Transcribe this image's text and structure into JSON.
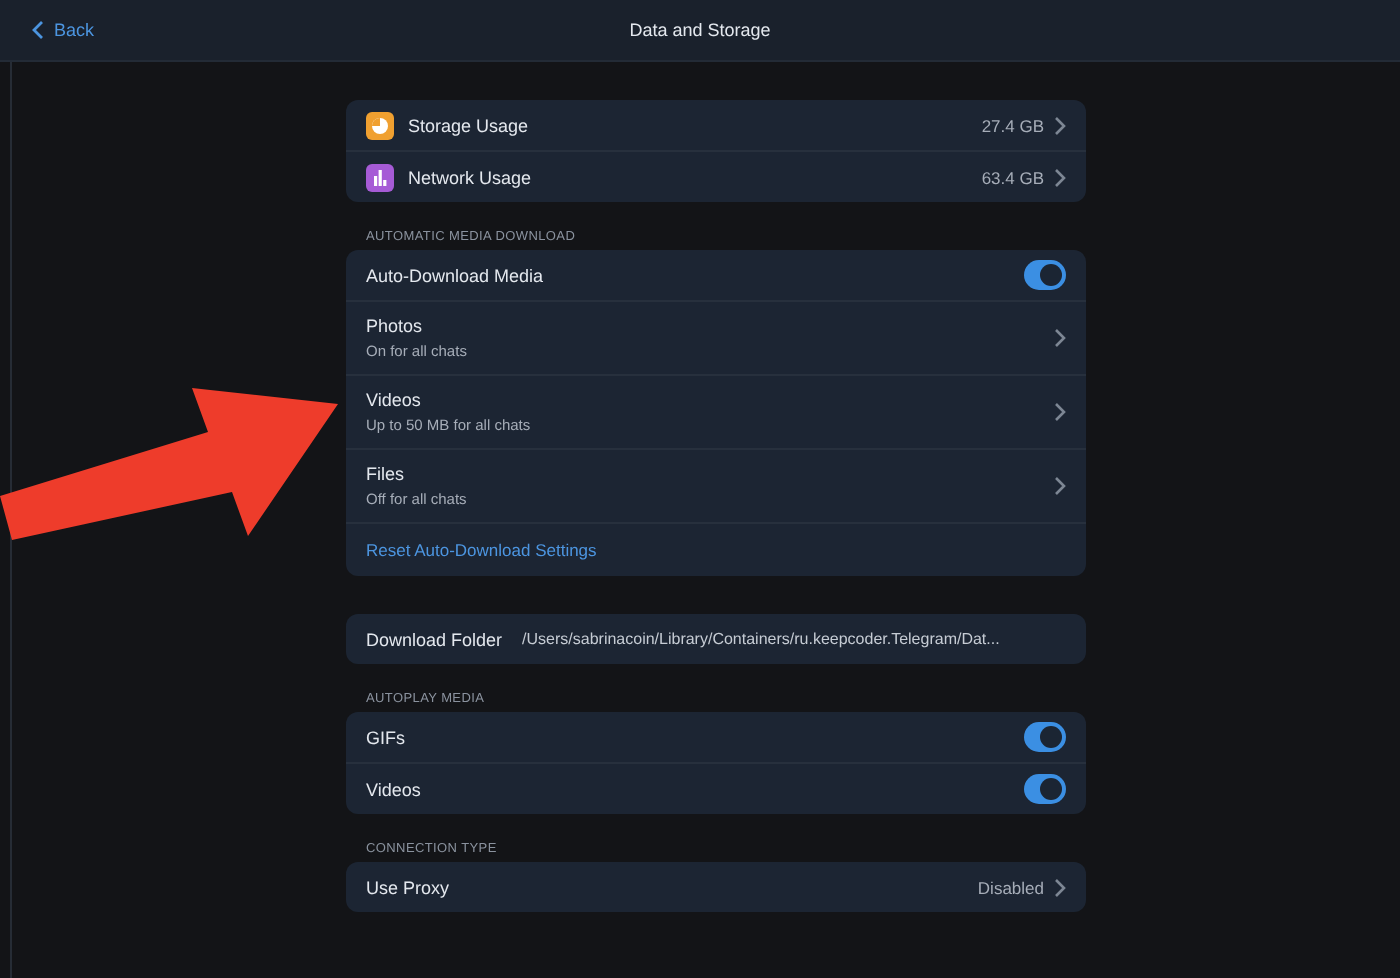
{
  "header": {
    "back": "Back",
    "title": "Data and Storage"
  },
  "sections": [
    {
      "rows": [
        {
          "kind": "storage",
          "label": "Storage Usage",
          "value": "27.4 GB",
          "color": "#f0a030"
        },
        {
          "kind": "network",
          "label": "Network Usage",
          "value": "63.4 GB",
          "color": "#a65bd6"
        }
      ]
    },
    {
      "title": "AUTOMATIC MEDIA DOWNLOAD",
      "rows": [
        {
          "kind": "toggle",
          "label": "Auto-Download Media",
          "on": true
        },
        {
          "kind": "detail",
          "label": "Photos",
          "subtitle": "On for all chats"
        },
        {
          "kind": "detail",
          "label": "Videos",
          "subtitle": "Up to 50 MB for all chats"
        },
        {
          "kind": "detail",
          "label": "Files",
          "subtitle": "Off for all chats"
        },
        {
          "kind": "link",
          "label": "Reset Auto-Download Settings"
        }
      ]
    },
    {
      "rows": [
        {
          "kind": "path",
          "label": "Download Folder",
          "value": "/Users/sabrinacoin/Library/Containers/ru.keepcoder.Telegram/Dat..."
        }
      ]
    },
    {
      "title": "AUTOPLAY MEDIA",
      "rows": [
        {
          "kind": "toggle",
          "label": "GIFs",
          "on": true
        },
        {
          "kind": "toggle",
          "label": "Videos",
          "on": true
        }
      ]
    },
    {
      "title": "CONNECTION TYPE",
      "rows": [
        {
          "kind": "value",
          "label": "Use Proxy",
          "value": "Disabled"
        }
      ]
    }
  ]
}
